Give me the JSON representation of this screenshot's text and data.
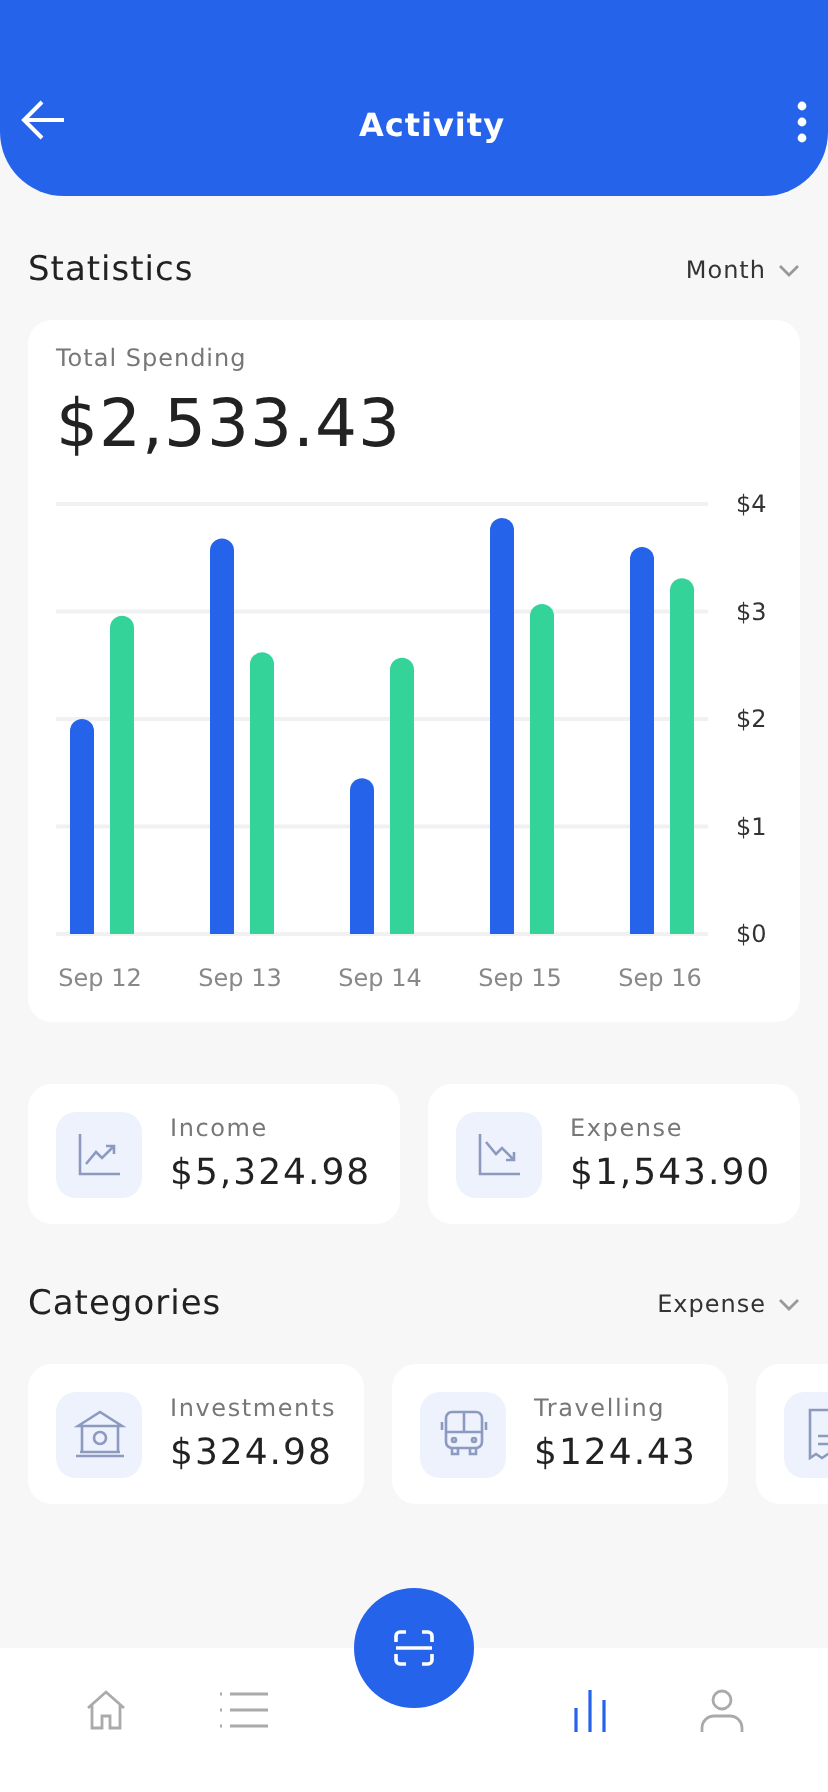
{
  "header": {
    "title": "Activity"
  },
  "statistics": {
    "title": "Statistics",
    "period": "Month",
    "card": {
      "label": "Total Spending",
      "amount": "$2,533.43",
      "chart_data": {
        "type": "bar",
        "grid": true,
        "categories": [
          "Sep 12",
          "Sep 13",
          "Sep 14",
          "Sep 15",
          "Sep 16"
        ],
        "ylim": [
          0,
          4
        ],
        "yticks": [
          {
            "value": 0,
            "label": "$0"
          },
          {
            "value": 1,
            "label": "$1"
          },
          {
            "value": 2,
            "label": "$2"
          },
          {
            "value": 3,
            "label": "$3"
          },
          {
            "value": 4,
            "label": "$4"
          }
        ],
        "series": [
          {
            "color": "#2563eb",
            "values": [
              2.0,
              3.68,
              1.45,
              3.87,
              3.6
            ]
          },
          {
            "color": "#34d399",
            "values": [
              2.96,
              2.62,
              2.57,
              3.07,
              3.31
            ]
          }
        ]
      }
    }
  },
  "summary": [
    {
      "kind": "up",
      "label": "Income",
      "amount": "$5,324.98"
    },
    {
      "kind": "down",
      "label": "Expense",
      "amount": "$1,543.90"
    }
  ],
  "categories": {
    "title": "Categories",
    "filter": "Expense",
    "items": [
      {
        "kind": "bank",
        "label": "Investments",
        "amount": "$324.98"
      },
      {
        "kind": "bus",
        "label": "Travelling",
        "amount": "$124.43"
      }
    ]
  },
  "nav": [
    {
      "selected": false
    },
    {
      "selected": false
    },
    {
      "selected": true
    },
    {
      "selected": false
    }
  ]
}
